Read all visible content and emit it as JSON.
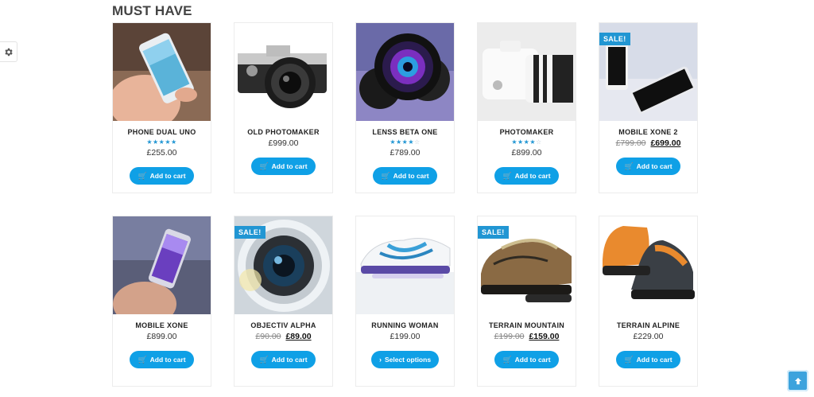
{
  "section": {
    "title": "MUST HAVE"
  },
  "colors": {
    "accent": "#0fa0e6",
    "sale_badge": "#2196d3"
  },
  "sale_badge_label": "SALE!",
  "products": [
    {
      "name": "PHONE DUAL UNO",
      "rating": 5,
      "price": "£255.00",
      "old_price": "",
      "sale_price": "",
      "button": "Add to cart",
      "sale": false,
      "icon": "cart-icon"
    },
    {
      "name": "OLD PHOTOMAKER",
      "rating": 0,
      "price": "£999.00",
      "old_price": "",
      "sale_price": "",
      "button": "Add to cart",
      "sale": false,
      "icon": "cart-icon"
    },
    {
      "name": "LENSS BETA ONE",
      "rating": 4,
      "price": "£789.00",
      "old_price": "",
      "sale_price": "",
      "button": "Add to cart",
      "sale": false,
      "icon": "cart-icon"
    },
    {
      "name": "PHOTOMAKER",
      "rating": 4,
      "price": "£899.00",
      "old_price": "",
      "sale_price": "",
      "button": "Add to cart",
      "sale": false,
      "icon": "cart-icon"
    },
    {
      "name": "MOBILE XONE 2",
      "rating": 0,
      "price": "",
      "old_price": "£799.00",
      "sale_price": "£699.00",
      "button": "Add to cart",
      "sale": true,
      "icon": "cart-icon"
    },
    {
      "name": "MOBILE XONE",
      "rating": 0,
      "price": "£899.00",
      "old_price": "",
      "sale_price": "",
      "button": "Add to cart",
      "sale": false,
      "icon": "cart-icon"
    },
    {
      "name": "OBJECTIV ALPHA",
      "rating": 0,
      "price": "",
      "old_price": "£90.00",
      "sale_price": "£89.00",
      "button": "Add to cart",
      "sale": true,
      "icon": "cart-icon"
    },
    {
      "name": "RUNNING WOMAN",
      "rating": 0,
      "price": "£199.00",
      "old_price": "",
      "sale_price": "",
      "button": "Select options",
      "sale": false,
      "icon": "chevron-right-icon"
    },
    {
      "name": "TERRAIN MOUNTAIN",
      "rating": 0,
      "price": "",
      "old_price": "£199.00",
      "sale_price": "£159.00",
      "button": "Add to cart",
      "sale": true,
      "icon": "cart-icon"
    },
    {
      "name": "TERRAIN ALPINE",
      "rating": 0,
      "price": "£229.00",
      "old_price": "",
      "sale_price": "",
      "button": "Add to cart",
      "sale": false,
      "icon": "cart-icon"
    }
  ],
  "settings_icon": "gear-icon",
  "scroll_top_icon": "arrow-up-icon"
}
